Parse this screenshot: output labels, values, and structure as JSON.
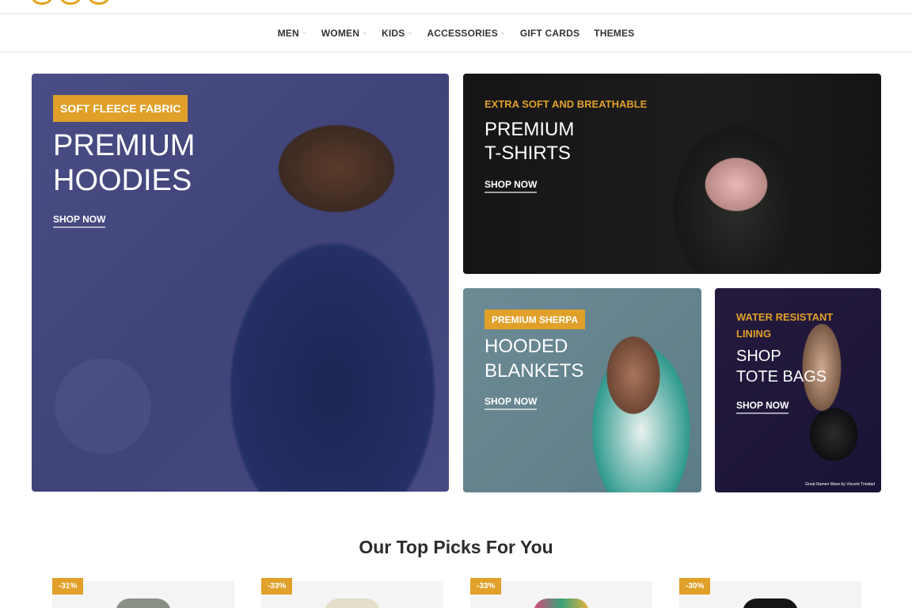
{
  "nav": {
    "items": [
      {
        "label": "MEN",
        "has_dropdown": true
      },
      {
        "label": "WOMEN",
        "has_dropdown": true
      },
      {
        "label": "KIDS",
        "has_dropdown": true
      },
      {
        "label": "ACCESSORIES",
        "has_dropdown": true
      },
      {
        "label": "GIFT CARDS",
        "has_dropdown": false
      },
      {
        "label": "THEMES",
        "has_dropdown": false
      }
    ]
  },
  "banners": {
    "hoodies": {
      "tag": "SOFT FLEECE FABRIC",
      "line1": "PREMIUM",
      "line2": "HOODIES",
      "cta": "SHOP NOW"
    },
    "tshirts": {
      "kicker": "EXTRA SOFT AND BREATHABLE",
      "line1": "PREMIUM",
      "line2": "T-SHIRTS",
      "cta": "SHOP NOW"
    },
    "blankets": {
      "tag": "PREMIUM SHERPA",
      "line1": "HOODED",
      "line2": "BLANKETS",
      "cta": "SHOP NOW"
    },
    "totes": {
      "kicker_line1": "WATER RESISTANT",
      "kicker_line2": "LINING",
      "line1": "SHOP",
      "line2": "TOTE BAGS",
      "cta": "SHOP NOW",
      "credit": "Great Ramen Wave by Vincent Trinidad"
    }
  },
  "section": {
    "title": "Our Top Picks For You"
  },
  "products": [
    {
      "discount": "-31%"
    },
    {
      "discount": "-33%"
    },
    {
      "discount": "-33%"
    },
    {
      "discount": "-30%"
    }
  ],
  "colors": {
    "accent": "#e0a029",
    "nav_text": "#333333"
  },
  "icons": {
    "nav_dropdown": "chevron-down-icon"
  }
}
